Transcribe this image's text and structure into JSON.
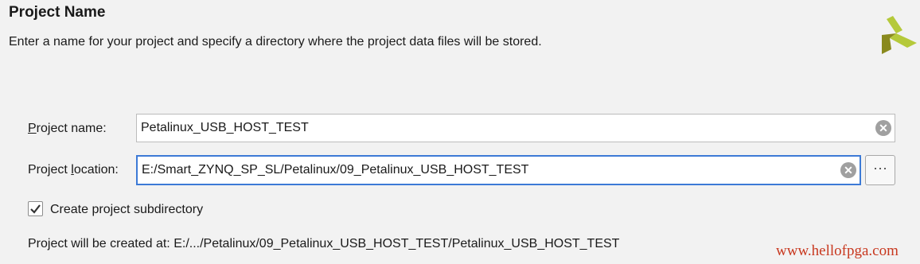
{
  "header": {
    "title": "Project Name",
    "subtitle": "Enter a name for your project and specify a directory where the project data files will be stored."
  },
  "form": {
    "name_label_mnemonic": "P",
    "name_label_rest": "roject name:",
    "name_value": "Petalinux_USB_HOST_TEST",
    "location_label_pre": "Project ",
    "location_label_mnemonic": "l",
    "location_label_post": "ocation:",
    "location_value": "E:/Smart_ZYNQ_SP_SL/Petalinux/09_Petalinux_USB_HOST_TEST",
    "browse_label": "···",
    "clear_symbol": "✕",
    "subdirectory_label": "Create project subdirectory",
    "subdirectory_checked": true,
    "status_text": "Project will be created at: E:/.../Petalinux/09_Petalinux_USB_HOST_TEST/Petalinux_USB_HOST_TEST"
  },
  "colors": {
    "background": "#f2f2f2",
    "focus_border": "#3d7ad6",
    "logo_olive": "#8a8a1e",
    "logo_green": "#b5c93a",
    "watermark": "#c8381f"
  },
  "watermark": "www.hellofpga.com"
}
